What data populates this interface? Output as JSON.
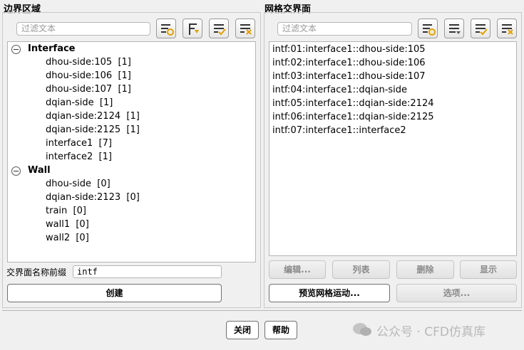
{
  "left": {
    "title": "边界区域",
    "filter_placeholder": "过滤文本",
    "toolbar": [
      "filter-icon",
      "sort-icon",
      "select-all-icon",
      "deselect-all-icon"
    ],
    "tree": [
      {
        "group": "Interface",
        "items": [
          "dhou-side:105  [1]",
          "dhou-side:106  [1]",
          "dhou-side:107  [1]",
          "dqian-side  [1]",
          "dqian-side:2124  [1]",
          "dqian-side:2125  [1]",
          "interface1  [7]",
          "interface2  [1]"
        ]
      },
      {
        "group": "Wall",
        "items": [
          "dhou-side  [0]",
          "dqian-side:2123  [0]",
          "train  [0]",
          "wall1  [0]",
          "wall2  [0]"
        ]
      }
    ],
    "prefix_label": "交界面名称前缀",
    "prefix_value": "intf",
    "create_button": "创建"
  },
  "right": {
    "title": "网格交界面",
    "filter_placeholder": "过滤文本",
    "toolbar": [
      "filter-icon",
      "sort-icon",
      "select-all-icon",
      "deselect-all-icon"
    ],
    "list": [
      "intf:01:interface1::dhou-side:105",
      "intf:02:interface1::dhou-side:106",
      "intf:03:interface1::dhou-side:107",
      "intf:04:interface1::dqian-side",
      "intf:05:interface1::dqian-side:2124",
      "intf:06:interface1::dqian-side:2125",
      "intf:07:interface1::interface2"
    ],
    "buttons": [
      "编辑...",
      "列表",
      "删除",
      "显示"
    ],
    "preview_button": "预览网格运动...",
    "options_button": "选项..."
  },
  "footer": {
    "close_button": "关闭",
    "help_button": "帮助"
  },
  "watermark": "公众号 · CFD仿真库"
}
